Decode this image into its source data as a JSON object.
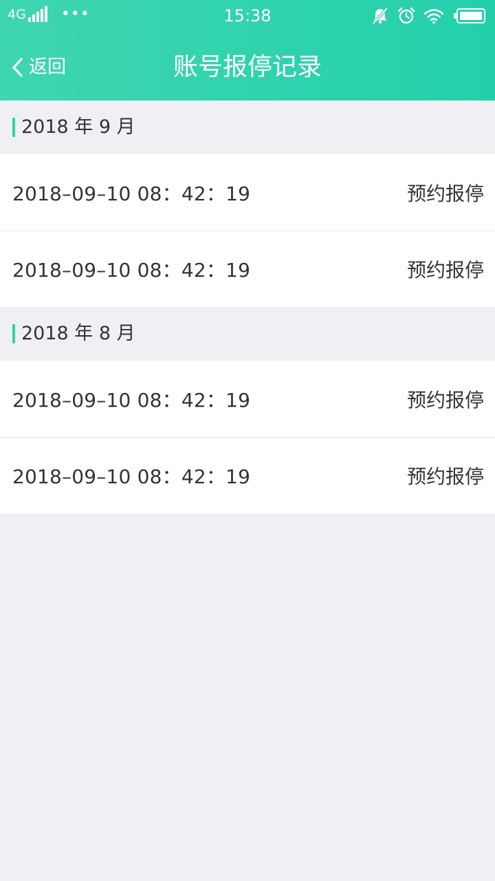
{
  "status_bar": {
    "carrier": "4G",
    "more": "•••",
    "time": "15:38",
    "battery_level": 0.9,
    "icons": [
      "signal-icon",
      "bell-off-icon",
      "alarm-clock-icon",
      "wifi-icon",
      "battery-icon"
    ]
  },
  "nav": {
    "back_label": "返回",
    "title": "账号报停记录"
  },
  "colors": {
    "header_gradient_start": "#3fd6b0",
    "header_gradient_end": "#24cfab",
    "accent": "#2dd2ae",
    "background": "#efeff4"
  },
  "sections": [
    {
      "title": "2018 年 9 月",
      "records": [
        {
          "time": "2018–09–10  08：42：19",
          "status": "预约报停"
        },
        {
          "time": "2018–09–10  08：42：19",
          "status": "预约报停"
        }
      ]
    },
    {
      "title": "2018 年 8 月",
      "records": [
        {
          "time": "2018–09–10  08：42：19",
          "status": "预约报停"
        },
        {
          "time": "2018–09–10  08：42：19",
          "status": "预约报停"
        }
      ]
    }
  ]
}
